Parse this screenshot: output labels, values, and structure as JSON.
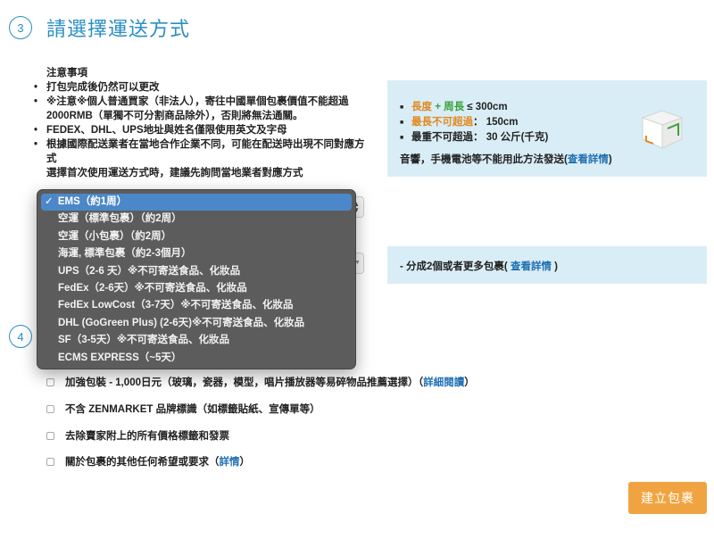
{
  "step3": {
    "number": "3",
    "title": "請選擇運送方式"
  },
  "step4": {
    "number": "4"
  },
  "notes": {
    "title": "注意事項",
    "items": [
      "打包完成後仍然可以更改",
      "※注意※個人普通買家（非法人），寄往中國單個包裹價值不能超過2000RMB（單獨不可分割商品除外），否則將無法通關。",
      "FEDEX、DHL、UPS地址與姓名僅限使用英文及字母",
      "根據國際配送業者在當地合作企業不同，可能在配送時出現不同對應方式"
    ],
    "extra": "選擇首次使用運送方式時，建議先詢問當地業者對應方式"
  },
  "size_info": {
    "line1_a": "長度",
    "line1_plus": " + ",
    "line1_b": "周長",
    "line1_c": " ≤ 300cm",
    "line2_a": "最長不可超過",
    "line2_b": "：  150cm",
    "line3": "最重不可超過：  30 公斤(千克)",
    "note": "音響，手機電池等不能用此方法發送(",
    "note_link": "查看詳情",
    "note_end": ")"
  },
  "split_info": {
    "text": "- 分成2個或者更多包裹( ",
    "link": "查看詳情",
    "end": " )"
  },
  "shipping_dropdown": {
    "check": "✓",
    "options": [
      "EMS（約1周）",
      "空運（標準包裹）（約2周）",
      "空運（小包裹）（約2周）",
      "海運, 標準包裹（約2-3個月）",
      "UPS（2-6 天）※不可寄送食品、化妝品",
      "FedEx（2-6天）※不可寄送食品、化妝品",
      "FedEx LowCost（3-7天）※不可寄送食品、化妝品",
      "DHL (GoGreen Plus) (2-6天)※不可寄送食品、化妝品",
      "SF（3-5天）※不可寄送食品、化妝品",
      "ECMS EXPRESS（~5天）"
    ],
    "selected_index": 0
  },
  "packing_options": [
    {
      "label": "加強包裝 - 1,000日元（玻璃，瓷器，模型，唱片播放器等易碎物品推薦選擇）（",
      "link": "詳細閱讀",
      "end": "）",
      "checked": false
    },
    {
      "label": "不含 ZENMARKET 品牌標識（如標籤貼紙、宣傳單等）",
      "link": "",
      "end": "",
      "checked": false
    },
    {
      "label": "去除賣家附上的所有價格標籤和發票",
      "link": "",
      "end": "",
      "checked": false
    },
    {
      "label": "關於包裹的其他任何希望或要求（",
      "link": "詳情",
      "end": "）",
      "checked": false
    }
  ],
  "create_button": "建立包裹",
  "colors": {
    "accent": "#2a8fc4",
    "info_bg": "#d9edf7",
    "button": "#f0a441",
    "orange": "#e08a1e",
    "green": "#3aa13a",
    "link": "#1f6fb2"
  },
  "icons": {
    "box": "open-box-icon",
    "checkbox": "checkbox-icon",
    "select_arrows": "select-arrows-icon"
  }
}
